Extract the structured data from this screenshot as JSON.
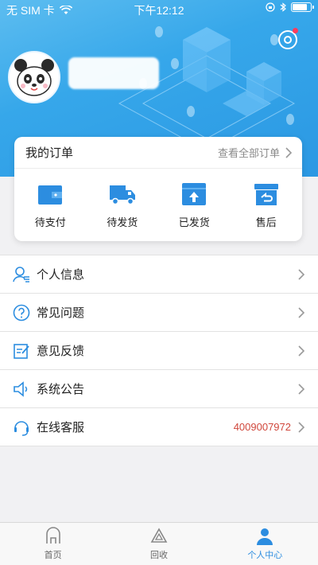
{
  "status_bar": {
    "carrier": "无 SIM 卡",
    "time": "下午12:12"
  },
  "colors": {
    "brand_blue": "#2c8de0",
    "phone_red": "#d0473c"
  },
  "profile": {
    "avatar_icon": "panda-avatar",
    "username_redacted": true
  },
  "orders": {
    "title": "我的订单",
    "view_all": "查看全部订单",
    "items": [
      {
        "label": "待支付",
        "icon": "wallet-icon"
      },
      {
        "label": "待发货",
        "icon": "truck-icon"
      },
      {
        "label": "已发货",
        "icon": "box-up-icon"
      },
      {
        "label": "售后",
        "icon": "return-box-icon"
      }
    ]
  },
  "menu": {
    "items": [
      {
        "label": "个人信息",
        "icon": "person-info-icon"
      },
      {
        "label": "常见问题",
        "icon": "question-icon"
      },
      {
        "label": "意见反馈",
        "icon": "feedback-icon"
      },
      {
        "label": "系统公告",
        "icon": "speaker-icon"
      },
      {
        "label": "在线客服",
        "icon": "headset-icon",
        "value": "4009007972"
      }
    ]
  },
  "tabbar": {
    "items": [
      {
        "label": "首页",
        "icon": "home-icon"
      },
      {
        "label": "回收",
        "icon": "recycle-icon"
      },
      {
        "label": "个人中心",
        "icon": "user-icon",
        "active": true
      }
    ]
  }
}
